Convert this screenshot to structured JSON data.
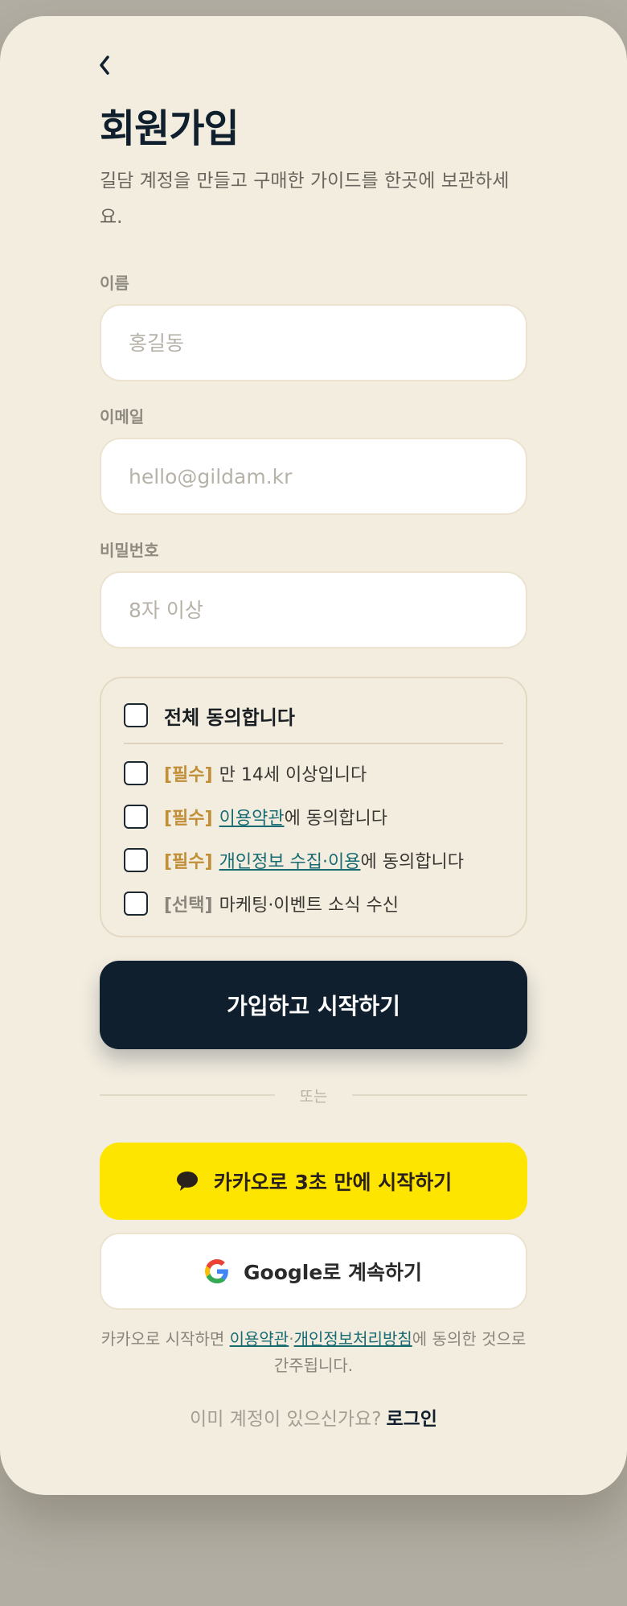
{
  "header": {
    "back_label": "‹",
    "title": "회원가입",
    "subtitle": "길담 계정을 만들고 구매한 가이드를 한곳에 보관하세요."
  },
  "form": {
    "name_label": "이름",
    "name_placeholder": "홍길동",
    "email_label": "이메일",
    "email_placeholder": "hello@gildam.kr",
    "password_label": "비밀번호",
    "password_placeholder": "8자 이상"
  },
  "terms": {
    "all_label": "전체 동의합니다",
    "items": [
      {
        "tag": "[필수]",
        "before": "만 14세 이상입니다",
        "link": "",
        "after": ""
      },
      {
        "tag": "[필수]",
        "before": "",
        "link": "이용약관",
        "after": "에 동의합니다"
      },
      {
        "tag": "[필수]",
        "before": "",
        "link": "개인정보 수집·이용",
        "after": "에 동의합니다"
      },
      {
        "tag": "[선택]",
        "before": "마케팅·이벤트 소식 수신",
        "link": "",
        "after": ""
      }
    ]
  },
  "actions": {
    "submit_label": "가입하고 시작하기",
    "or_label": "또는",
    "kakao_label": "카카오로 3초 만에 시작하기",
    "google_label": "Google로 계속하기"
  },
  "footer": {
    "note_prefix": "카카오로 시작하면 ",
    "note_link1": "이용약관",
    "note_sep": "·",
    "note_link2": "개인정보처리방침",
    "note_suffix": "에 동의한 것으로 간주됩니다.",
    "login_prompt": "이미 계정이 있으신가요?",
    "login_link": "로그인"
  },
  "icons": {
    "back": "chevron-left-icon",
    "kakao": "speech-bubble-icon",
    "google": "google-g-icon"
  },
  "colors": {
    "background": "#f3ede0",
    "primary": "#0f1f2d",
    "kakao": "#fee500",
    "required_tag": "#c18f38",
    "link": "#176b73"
  }
}
